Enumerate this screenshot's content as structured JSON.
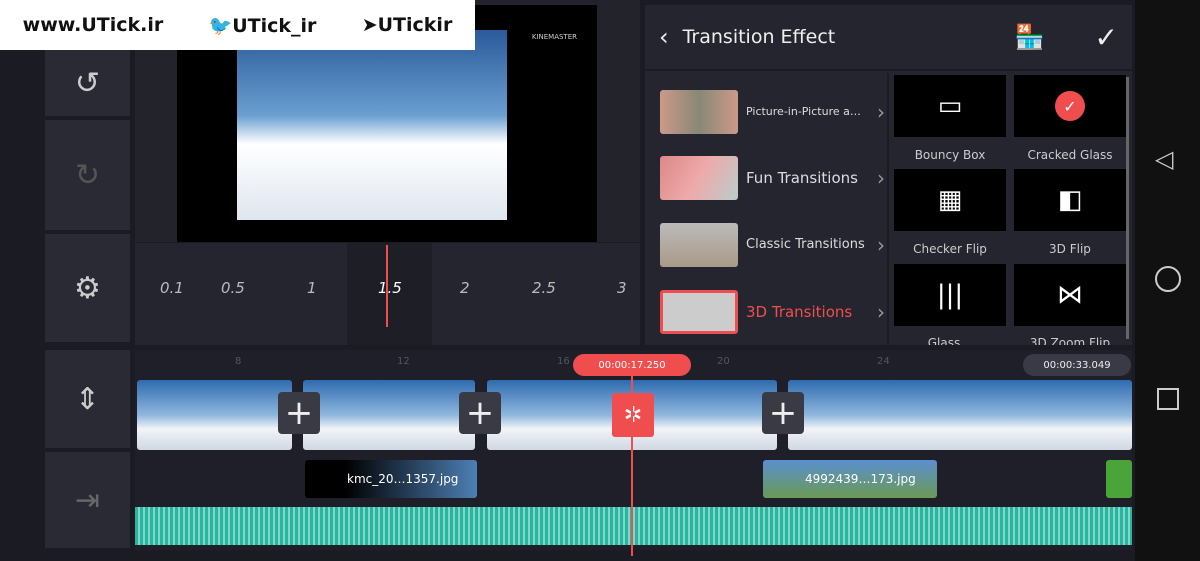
{
  "watermark": {
    "site": "www.UTick.ir",
    "twitter": "UTick_ir",
    "telegram": "UTickir"
  },
  "preview": {
    "logo": "KINEMASTER"
  },
  "ruler": {
    "ticks": [
      "0.1",
      "0.5",
      "1",
      "1.5",
      "2",
      "2.5",
      "3"
    ],
    "selected": "1.5"
  },
  "panel": {
    "title": "Transition Effect",
    "categories": [
      {
        "label": "Picture-in-Picture a…"
      },
      {
        "label": "Fun Transitions"
      },
      {
        "label": "Classic Transitions"
      },
      {
        "label": "3D Transitions",
        "selected": true
      }
    ],
    "effects": [
      {
        "label": "Bouncy Box"
      },
      {
        "label": "Cracked Glass",
        "selected": true
      },
      {
        "label": "Checker Flip"
      },
      {
        "label": "3D Flip"
      },
      {
        "label": "Glass…"
      },
      {
        "label": "3D Zoom Flip"
      }
    ]
  },
  "timeline": {
    "ticks": [
      "8",
      "12",
      "16",
      "20",
      "24"
    ],
    "current_time": "00:00:17.250",
    "total_time": "00:00:33.049",
    "layers": [
      {
        "label": "kmc_20…1357.jpg"
      },
      {
        "label": "4992439…173.jpg"
      }
    ]
  },
  "colors": {
    "accent": "#f04e4e",
    "audio": "#2bb5a0"
  }
}
